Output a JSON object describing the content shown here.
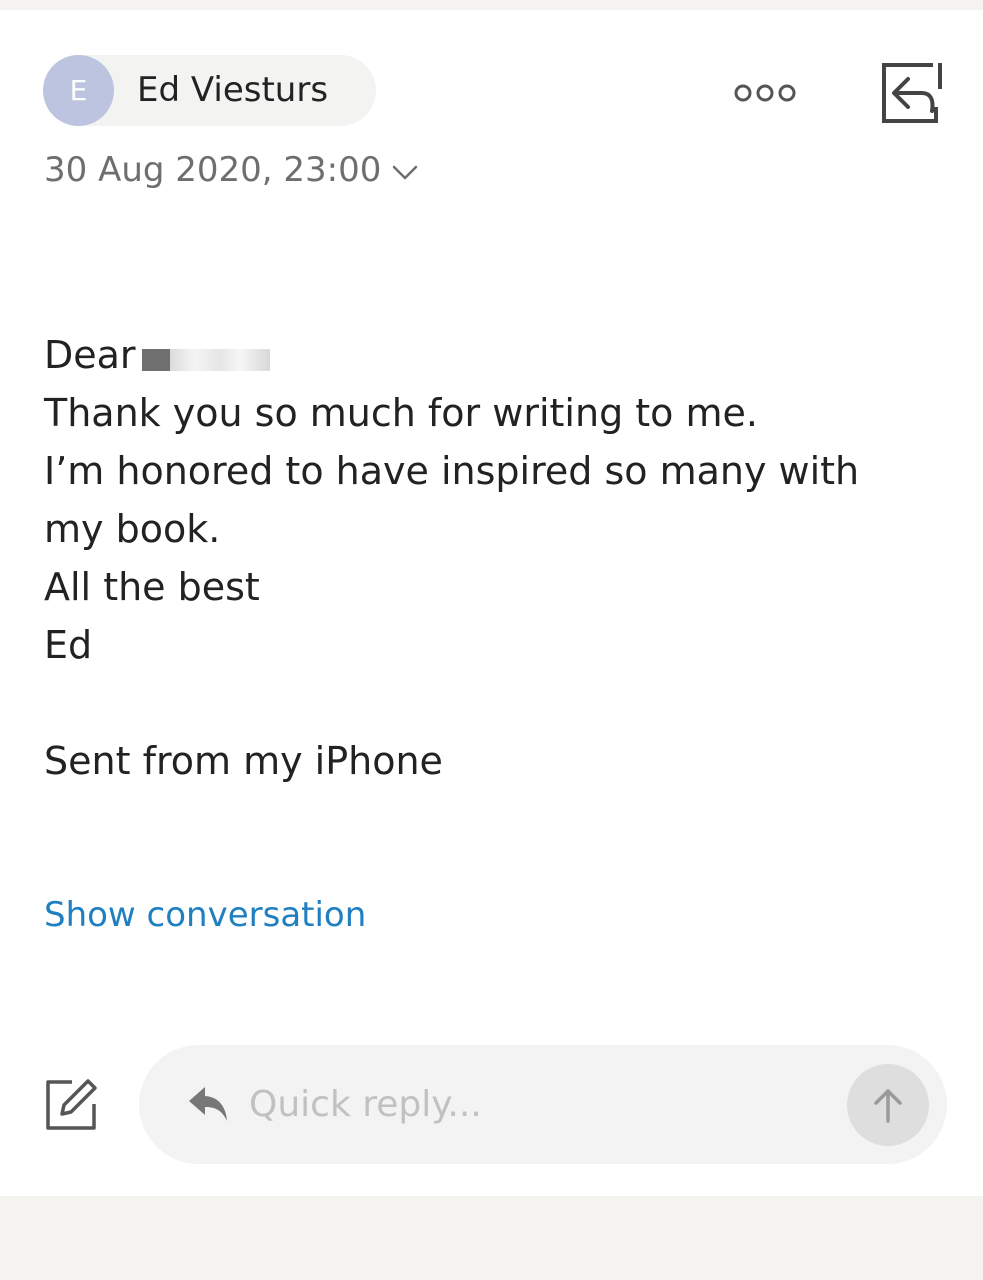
{
  "message": {
    "sender": {
      "avatar_letter": "E",
      "name": "Ed Viesturs"
    },
    "date": "30 Aug 2020, 23:00",
    "body": {
      "greeting": "Dear",
      "lines": [
        "Thank you so much for writing to me.",
        "I’m honored to have inspired so many with",
        "my book.",
        "All the best",
        "Ed"
      ],
      "signature": "Sent from my iPhone"
    },
    "show_conversation_label": "Show conversation"
  },
  "toolbar": {
    "more_icon": "more-horizontal-icon",
    "reply_icon": "reply-icon"
  },
  "composer": {
    "compose_icon": "compose-icon",
    "reply_icon": "reply-arrow-icon",
    "placeholder": "Quick reply...",
    "send_icon": "arrow-up-icon"
  },
  "colors": {
    "avatar": "#bcc4e0",
    "link": "#1f7fc1",
    "secondary_text": "#6e6e6e",
    "placeholder": "#c1c1c1",
    "send_button": "#dedede"
  }
}
